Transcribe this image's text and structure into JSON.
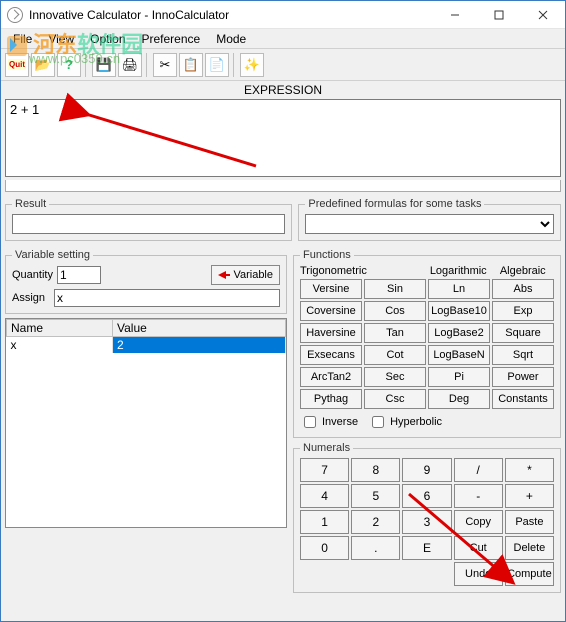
{
  "window": {
    "title": "Innovative Calculator - InnoCalculator"
  },
  "menu": {
    "file": "File",
    "view": "View",
    "option": "Option",
    "preference": "Preference",
    "mode": "Mode"
  },
  "expression": {
    "label": "EXPRESSION",
    "value": "2 + 1"
  },
  "result": {
    "legend": "Result",
    "value": ""
  },
  "predef": {
    "legend": "Predefined formulas for some tasks",
    "selected": ""
  },
  "varsetting": {
    "legend": "Variable setting",
    "quantity_label": "Quantity",
    "quantity": "1",
    "btn": "Variable",
    "assign_label": "Assign",
    "assign": "x"
  },
  "vartable": {
    "headers": [
      "Name",
      "Value"
    ],
    "rows": [
      {
        "name": "x",
        "value": "2",
        "value_selected": true
      }
    ]
  },
  "functions": {
    "legend": "Functions",
    "cats": [
      "Trigonometric",
      "Logarithmic",
      "Algebraic"
    ],
    "grid": [
      "Versine",
      "Sin",
      "Ln",
      "Abs",
      "Coversine",
      "Cos",
      "LogBase10",
      "Exp",
      "Haversine",
      "Tan",
      "LogBase2",
      "Square",
      "Exsecans",
      "Cot",
      "LogBaseN",
      "Sqrt",
      "ArcTan2",
      "Sec",
      "Pi",
      "Power",
      "Pythag",
      "Csc",
      "Deg",
      "Constants"
    ],
    "inverse_label": "Inverse",
    "hyperbolic_label": "Hyperbolic"
  },
  "numerals": {
    "legend": "Numerals",
    "grid": [
      "7",
      "8",
      "9",
      "/",
      "*",
      "4",
      "5",
      "6",
      "-",
      "+",
      "1",
      "2",
      "3",
      "Copy",
      "Paste",
      "0",
      ".",
      "E",
      "Cut",
      "Delete",
      "",
      "",
      "",
      "Undo",
      "Compute"
    ]
  },
  "watermark": {
    "line1a": "河东",
    "line1b": "软件园",
    "line2": "www.pc0359.cn"
  }
}
